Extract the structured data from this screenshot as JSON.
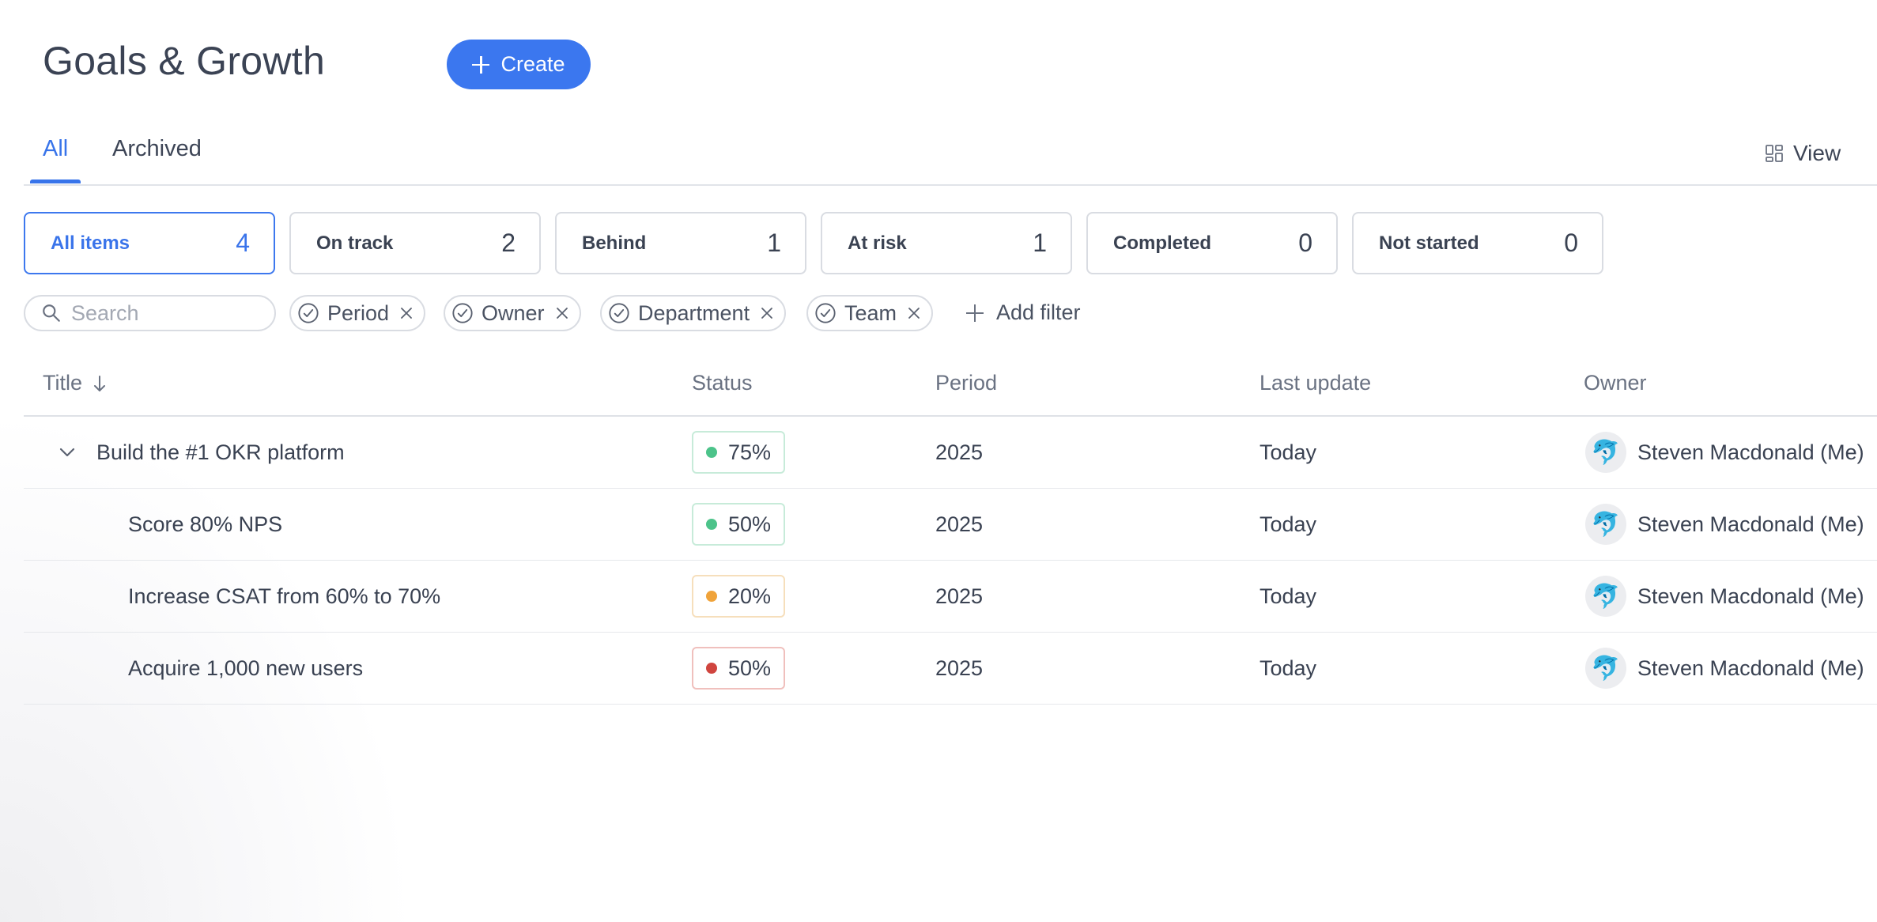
{
  "header": {
    "title": "Goals & Growth",
    "create_label": "Create"
  },
  "tabs": [
    {
      "label": "All",
      "active": true
    },
    {
      "label": "Archived",
      "active": false
    }
  ],
  "view_label": "View",
  "status_cards": [
    {
      "label": "All items",
      "count": "4",
      "active": true
    },
    {
      "label": "On track",
      "count": "2",
      "active": false
    },
    {
      "label": "Behind",
      "count": "1",
      "active": false
    },
    {
      "label": "At risk",
      "count": "1",
      "active": false
    },
    {
      "label": "Completed",
      "count": "0",
      "active": false
    },
    {
      "label": "Not started",
      "count": "0",
      "active": false
    }
  ],
  "search": {
    "placeholder": "Search",
    "value": ""
  },
  "filters": [
    {
      "label": "Period"
    },
    {
      "label": "Owner"
    },
    {
      "label": "Department"
    },
    {
      "label": "Team"
    }
  ],
  "add_filter_label": "Add filter",
  "table": {
    "columns": [
      "Title",
      "Status",
      "Period",
      "Last update",
      "Owner"
    ],
    "rows": [
      {
        "title": "Build the #1 OKR platform",
        "level": 0,
        "expanded": true,
        "status": "75%",
        "status_color": "#4cc38a",
        "status_border": "#c7ebd9",
        "period": "2025",
        "last_update": "Today",
        "owner": "Steven Macdonald (Me)",
        "avatar": "🐬"
      },
      {
        "title": "Score 80% NPS",
        "level": 1,
        "expanded": false,
        "status": "50%",
        "status_color": "#4cc38a",
        "status_border": "#c7ebd9",
        "period": "2025",
        "last_update": "Today",
        "owner": "Steven Macdonald (Me)",
        "avatar": "🐬"
      },
      {
        "title": "Increase CSAT from 60% to 70%",
        "level": 1,
        "expanded": false,
        "status": "20%",
        "status_color": "#f0a33a",
        "status_border": "#f6dfbc",
        "period": "2025",
        "last_update": "Today",
        "owner": "Steven Macdonald (Me)",
        "avatar": "🐬"
      },
      {
        "title": "Acquire 1,000 new users",
        "level": 1,
        "expanded": false,
        "status": "50%",
        "status_color": "#d0453f",
        "status_border": "#f0c0bd",
        "period": "2025",
        "last_update": "Today",
        "owner": "Steven Macdonald (Me)",
        "avatar": "🐬"
      }
    ]
  },
  "colors": {
    "accent": "#3b77ef",
    "on_track": "#4cc38a",
    "behind": "#f0a33a",
    "at_risk": "#d0453f"
  }
}
